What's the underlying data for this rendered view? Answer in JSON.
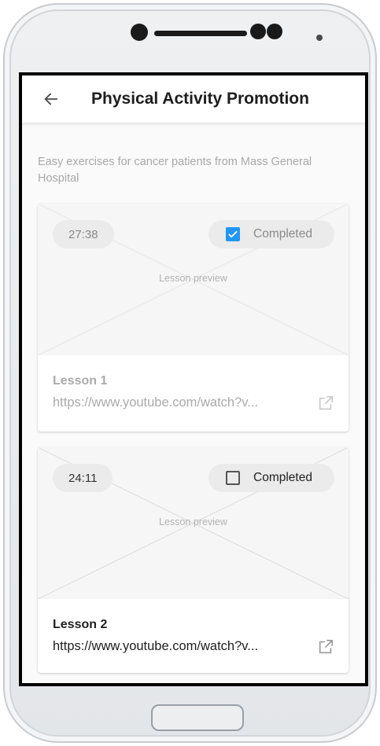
{
  "app": {
    "title": "Physical Activity Promotion",
    "back_icon": "arrow-left-icon"
  },
  "subtitle": "Easy exercises for cancer patients from Mass General Hospital",
  "lessons": [
    {
      "duration": "27:38",
      "completed": true,
      "completed_label": "Completed",
      "preview_label": "Lesson preview",
      "title": "Lesson 1",
      "url": "https://www.youtube.com/watch?v..."
    },
    {
      "duration": "24:11",
      "completed": false,
      "completed_label": "Completed",
      "preview_label": "Lesson preview",
      "title": "Lesson 2",
      "url": "https://www.youtube.com/watch?v..."
    }
  ],
  "colors": {
    "accent": "#2196f3",
    "title_text": "#1e1e1e",
    "muted_text": "#aaaaaa"
  }
}
